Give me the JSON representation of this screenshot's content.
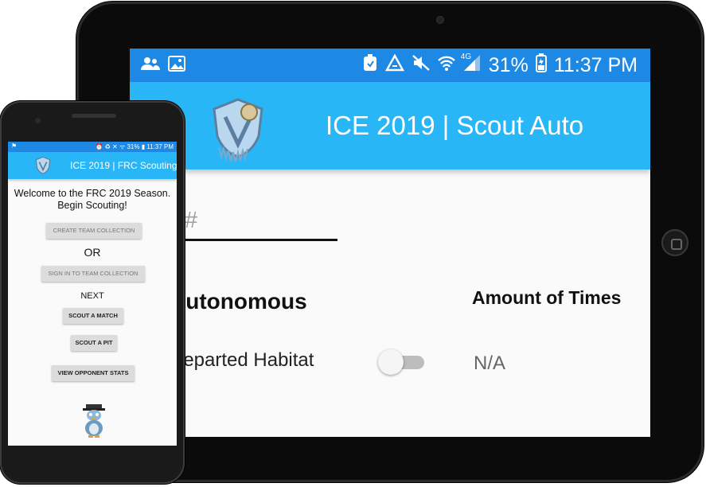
{
  "tablet": {
    "status_bar": {
      "battery": "31%",
      "time": "11:37 PM",
      "network": "4G",
      "left_icons": [
        "people-icon",
        "image-icon"
      ],
      "right_icons": [
        "alarm-icon",
        "recycle-icon",
        "mute-icon",
        "wifi-icon",
        "signal-icon",
        "battery-icon"
      ]
    },
    "app_bar": {
      "title": "ICE 2019 | Scout Auto"
    },
    "form": {
      "team_placeholder": "Team #",
      "section_title": "Autonomous",
      "column_header": "Amount of Times",
      "row_label": "Departed Habitat",
      "toggle_on": false,
      "row_value": "N/A"
    }
  },
  "phone": {
    "status_bar": {
      "left": "⚑",
      "right": "⏰ ♻ ✕ ᯤ 31% ▮ 11:37 PM"
    },
    "app_bar": {
      "title": "ICE 2019 | FRC Scouting"
    },
    "welcome": "Welcome to the FRC 2019 Season. Begin Scouting!",
    "buttons": {
      "create": "CREATE TEAM COLLECTION",
      "or": "OR",
      "sign_in": "SIGN IN TO TEAM COLLECTION",
      "next": "NEXT",
      "scout_match": "SCOUT A MATCH",
      "scout_pit": "SCOUT A PIT",
      "view_stats": "VIEW OPPONENT STATS"
    }
  },
  "colors": {
    "status_bar": "#1e88e5",
    "app_bar": "#29b6f6",
    "device_frame": "#0b0b0b"
  }
}
